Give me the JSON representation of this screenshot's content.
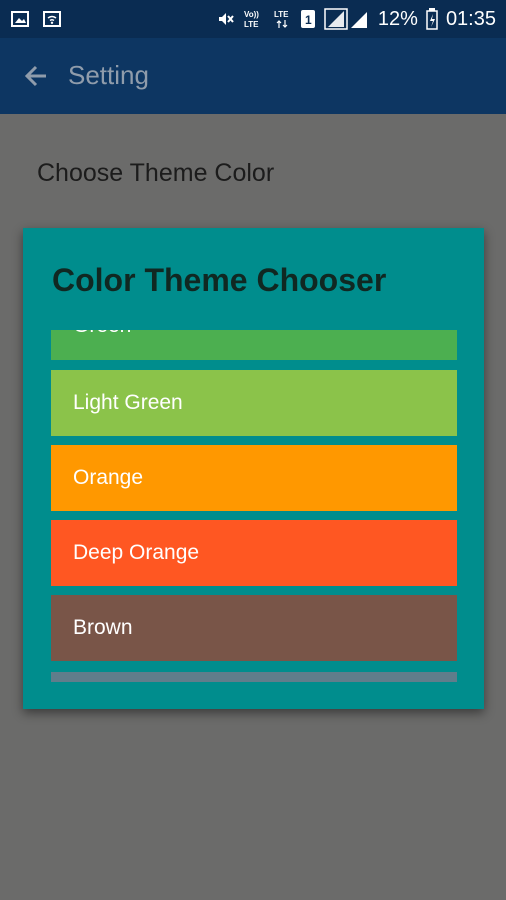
{
  "status_bar": {
    "battery": "12%",
    "time": "01:35"
  },
  "app_bar": {
    "title": "Setting"
  },
  "content": {
    "section_title": "Choose Theme Color"
  },
  "dialog": {
    "title": "Color Theme Chooser",
    "items": [
      {
        "label": "Green",
        "color": "#4caf50"
      },
      {
        "label": "Light Green",
        "color": "#8bc34a"
      },
      {
        "label": "Orange",
        "color": "#ff9800"
      },
      {
        "label": "Deep Orange",
        "color": "#ff5722"
      },
      {
        "label": "Brown",
        "color": "#795548"
      }
    ],
    "next_item_color": "#607d8b"
  },
  "icons": {
    "back": "arrow-back-icon",
    "gallery": "gallery-icon",
    "wifi": "wifi-icon",
    "mute": "mute-icon",
    "volte": "volte-icon",
    "lte": "lte-icon",
    "sim": "sim-icon",
    "signal": "signal-icon",
    "battery": "battery-icon"
  }
}
